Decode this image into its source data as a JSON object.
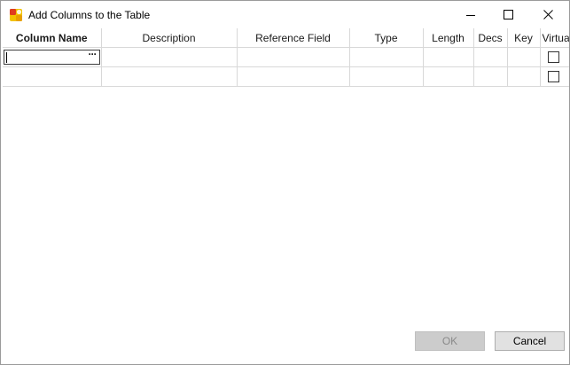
{
  "window": {
    "title": "Add Columns to the Table"
  },
  "grid": {
    "headers": [
      "Column Name",
      "Description",
      "Reference Field",
      "Type",
      "Length",
      "Decs",
      "Key",
      "Virtual"
    ],
    "rows": [
      {
        "virtual_checked": false
      },
      {
        "virtual_checked": false
      }
    ],
    "ellipsis_label": "···"
  },
  "buttons": {
    "ok_label": "OK",
    "cancel_label": "Cancel"
  }
}
